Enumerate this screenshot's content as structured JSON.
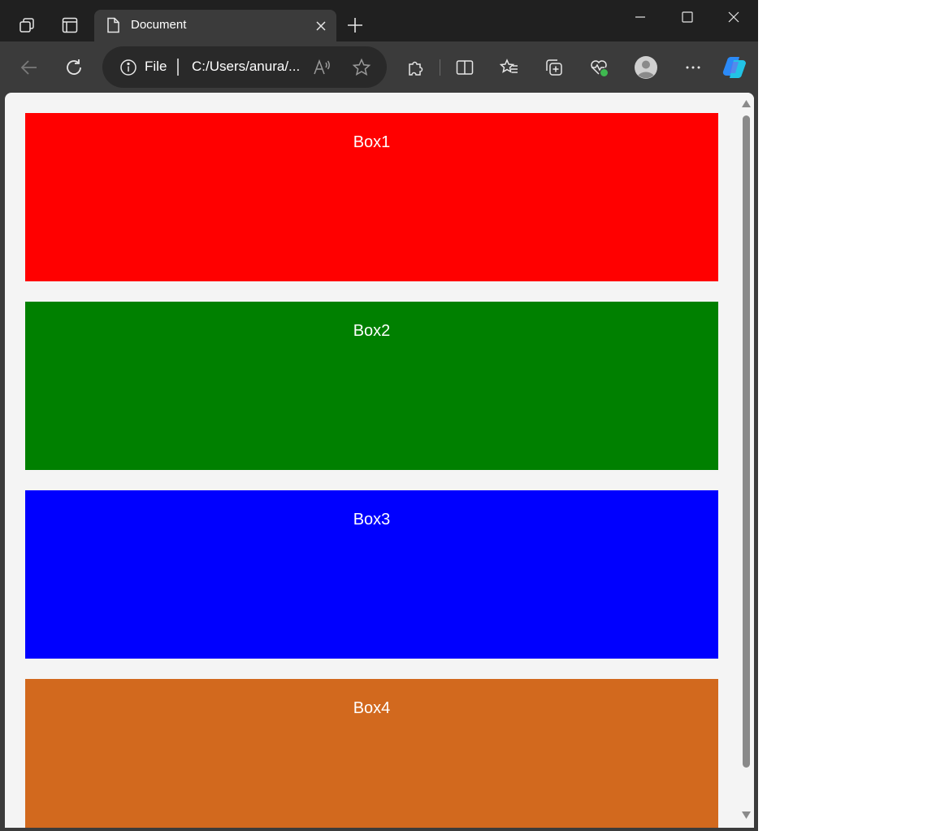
{
  "tab": {
    "title": "Document"
  },
  "address": {
    "scheme": "File",
    "url": "C:/Users/anura/..."
  },
  "boxes": [
    {
      "label": "Box1",
      "color": "#ff0000"
    },
    {
      "label": "Box2",
      "color": "#008000"
    },
    {
      "label": "Box3",
      "color": "#0000ff"
    },
    {
      "label": "Box4",
      "color": "#d2691e"
    }
  ],
  "icons": {
    "workspaces": "workspaces-icon",
    "tab_actions": "tab-actions-icon",
    "page": "page-icon",
    "close": "close-icon",
    "new_tab": "plus-icon",
    "minimize": "minimize-icon",
    "maximize": "maximize-icon",
    "window_close": "window-close-icon",
    "back": "back-arrow-icon",
    "refresh": "refresh-icon",
    "info": "info-icon",
    "read_aloud": "read-aloud-icon",
    "favorite": "star-icon",
    "extensions": "extensions-icon",
    "split_screen": "split-screen-icon",
    "favorites": "favorites-icon",
    "collections": "collections-icon",
    "browser_essentials": "heart-pulse-icon",
    "profile": "profile-avatar-icon",
    "more": "more-icon",
    "copilot": "copilot-icon"
  }
}
